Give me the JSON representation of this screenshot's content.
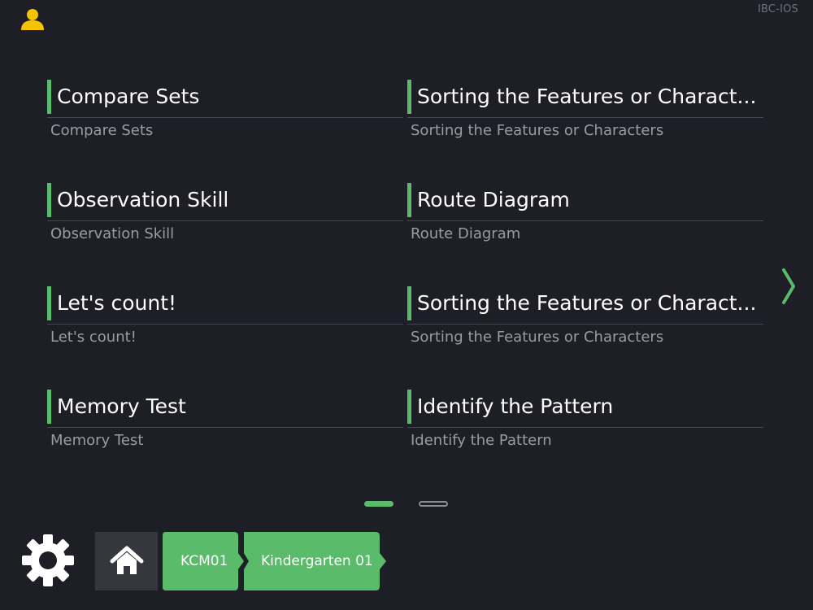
{
  "app": {
    "id_label": "IBC-IOS"
  },
  "colors": {
    "background": "#1e1e26",
    "accent": "#5abb6b",
    "user_icon": "#f5c400",
    "subtitle": "#9a9ca3",
    "home_button": "#35363e"
  },
  "icons": {
    "user": "user-icon",
    "next": "chevron-right-icon",
    "settings": "gear-icon",
    "home": "home-icon"
  },
  "lessons": [
    {
      "title": "Compare Sets",
      "subtitle": "Compare Sets"
    },
    {
      "title": "Sorting the Features or Charact...",
      "subtitle": "Sorting the Features or Characters"
    },
    {
      "title": "Observation Skill",
      "subtitle": "Observation Skill"
    },
    {
      "title": "Route Diagram",
      "subtitle": "Route Diagram"
    },
    {
      "title": "Let's count!",
      "subtitle": "Let's count!"
    },
    {
      "title": "Sorting the Features or Charact...",
      "subtitle": "Sorting the Features or Characters"
    },
    {
      "title": "Memory Test",
      "subtitle": "Memory Test"
    },
    {
      "title": "Identify the Pattern",
      "subtitle": "Identify the Pattern"
    }
  ],
  "pagination": {
    "total_pages": 2,
    "current_page": 1
  },
  "breadcrumb": [
    {
      "label": "KCM01"
    },
    {
      "label": "Kindergarten 01"
    }
  ]
}
